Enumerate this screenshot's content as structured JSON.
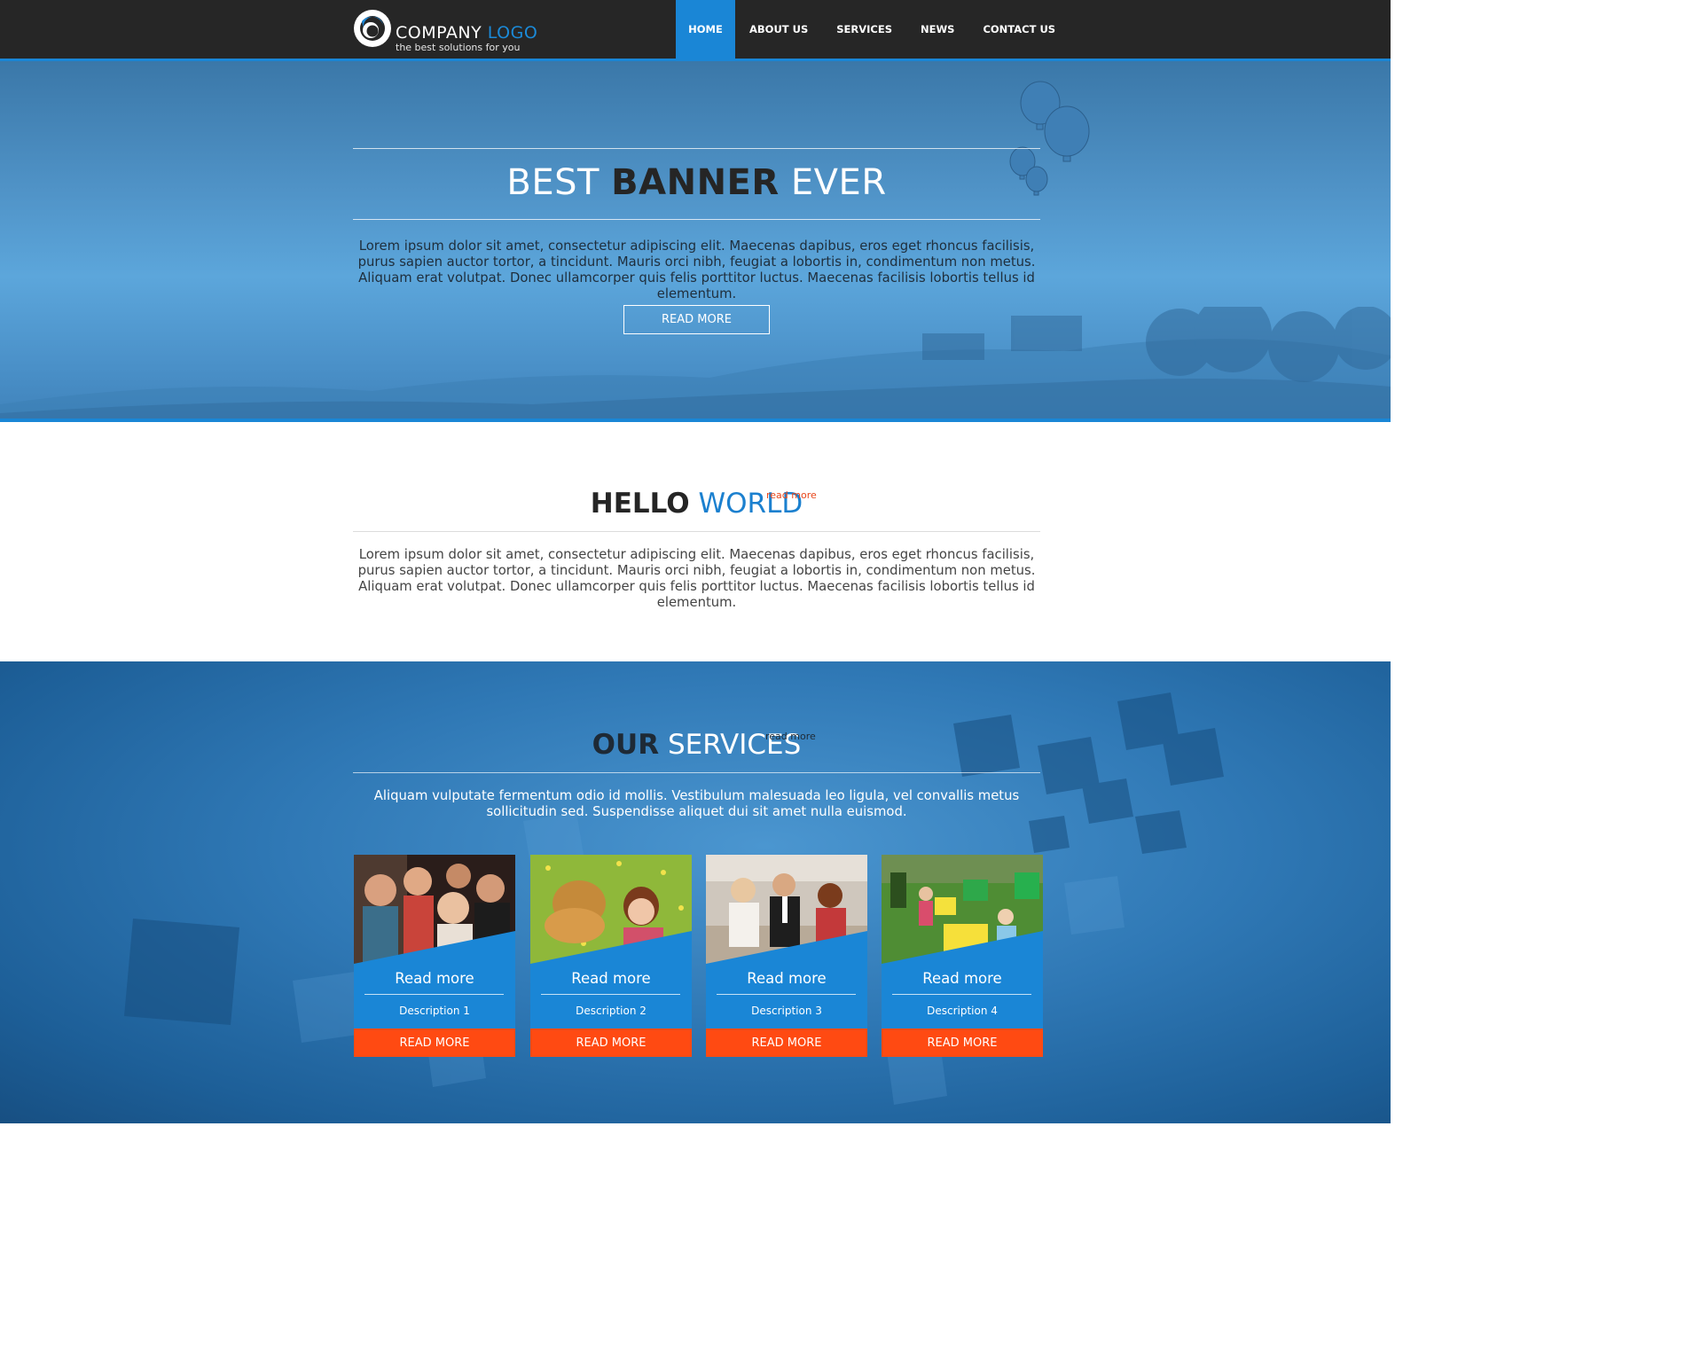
{
  "header": {
    "logo_word_1": "COMPANY",
    "logo_word_2": "LOGO",
    "tagline": "the best solutions for you",
    "nav": [
      {
        "label": "HOME",
        "active": true
      },
      {
        "label": "ABOUT US",
        "active": false
      },
      {
        "label": "SERVICES",
        "active": false
      },
      {
        "label": "NEWS",
        "active": false
      },
      {
        "label": "CONTACT US",
        "active": false
      }
    ]
  },
  "hero": {
    "title_part_1": "BEST",
    "title_part_2": "BANNER",
    "title_part_3": "EVER",
    "text": "Lorem ipsum dolor sit amet, consectetur adipiscing elit. Maecenas dapibus, eros eget rhoncus facilisis, purus sapien auctor tortor, a tincidunt. Mauris orci nibh, feugiat a lobortis in, condimentum non metus. Aliquam erat volutpat. Donec ullamcorper quis felis porttitor luctus. Maecenas facilisis lobortis tellus id elementum.",
    "button": "READ MORE"
  },
  "hello": {
    "title_dark": "HELLO",
    "title_blue": "WORLD",
    "read_more": "read more",
    "text": "Lorem ipsum dolor sit amet, consectetur adipiscing elit. Maecenas dapibus, eros eget rhoncus facilisis, purus sapien auctor tortor, a tincidunt. Mauris orci nibh, feugiat a lobortis in, condimentum non metus. Aliquam erat volutpat. Donec ullamcorper quis felis porttitor luctus. Maecenas facilisis lobortis tellus id elementum."
  },
  "services": {
    "title_dark": "OUR",
    "title_light": "SERVICES",
    "read_more": "read more",
    "text": "Aliquam vulputate fermentum odio id mollis. Vestibulum malesuada leo ligula, vel convallis metus sollicitudin sed. Suspendisse aliquet dui sit amet nulla euismod.",
    "cards": [
      {
        "heading": "Read more",
        "description": "Description 1",
        "button": "READ MORE",
        "image": "friends-party-photo"
      },
      {
        "heading": "Read more",
        "description": "Description 2",
        "button": "READ MORE",
        "image": "girl-with-dog-photo"
      },
      {
        "heading": "Read more",
        "description": "Description 3",
        "button": "READ MORE",
        "image": "limousine-celebration-photo"
      },
      {
        "heading": "Read more",
        "description": "Description 4",
        "button": "READ MORE",
        "image": "kids-pillow-fight-photo"
      }
    ]
  },
  "colors": {
    "nav_bg": "#262626",
    "accent_blue": "#1a86d6",
    "accent_orange": "#ff4a12"
  }
}
